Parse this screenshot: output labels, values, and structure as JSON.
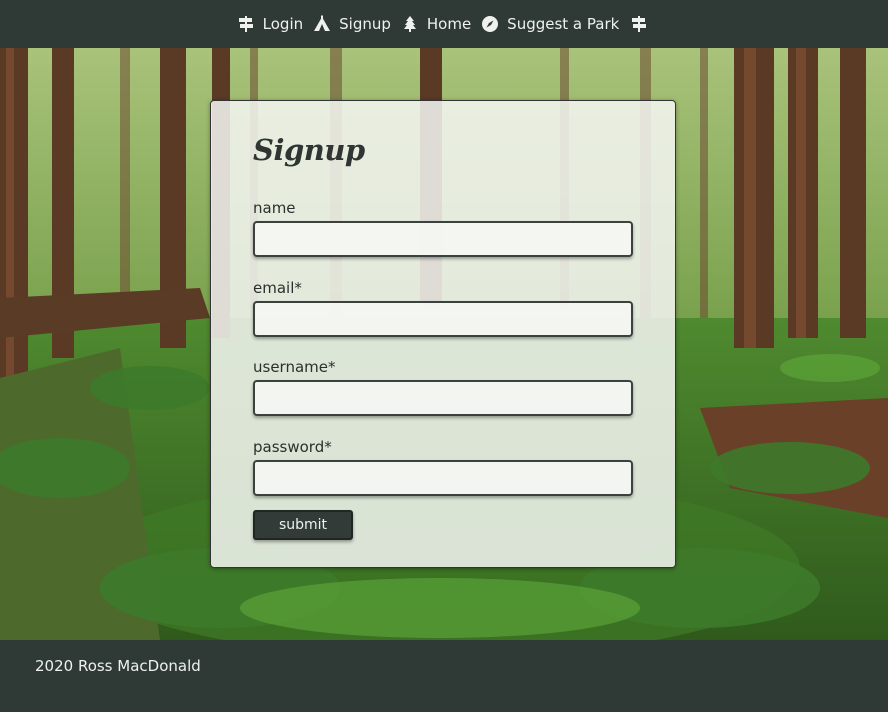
{
  "nav": {
    "items": [
      {
        "label": "Login",
        "icon": "signpost-icon"
      },
      {
        "label": "Signup",
        "icon": "campground-icon"
      },
      {
        "label": "Home",
        "icon": "tree-icon"
      },
      {
        "label": "Suggest a Park",
        "icon": "compass-icon"
      }
    ],
    "end_icon": "signpost-icon"
  },
  "form": {
    "title": "Signup",
    "fields": [
      {
        "label": "name",
        "value": ""
      },
      {
        "label": "email*",
        "value": ""
      },
      {
        "label": "username*",
        "value": ""
      },
      {
        "label": "password*",
        "value": ""
      }
    ],
    "submit_label": "submit"
  },
  "footer": {
    "text": "2020 Ross MacDonald"
  },
  "colors": {
    "nav_bg": "#2f3a37",
    "footer_bg": "#2f3a37",
    "button_bg": "#323b38",
    "card_bg": "#f5f6f2"
  }
}
